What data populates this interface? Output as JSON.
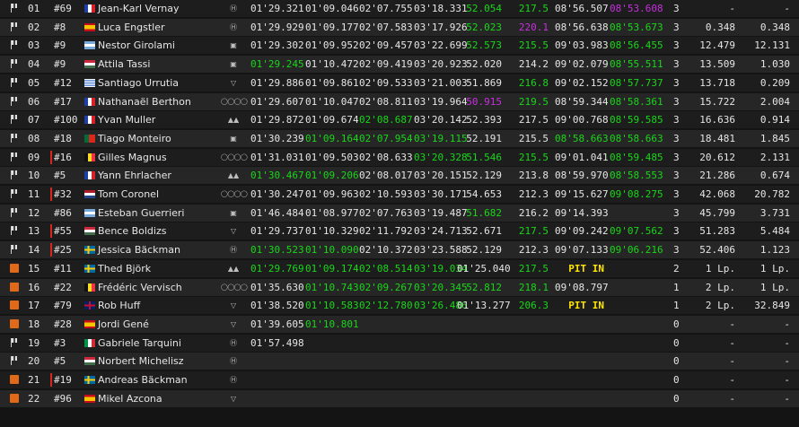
{
  "colors": {
    "personal_best": "#19d719",
    "overall_best": "#c72fdf",
    "pit": "#ffe600",
    "retired": "#e06a1a",
    "penalty": "#d9261c"
  },
  "rows": [
    {
      "status": "flag",
      "pos": "01",
      "num": "#69",
      "penalty": false,
      "flag": "fr",
      "driver": "Jean-Karl Vernay",
      "brand": "hyundai",
      "best": "01'29.321",
      "s1": "01'09.046",
      "s2": "02'07.755",
      "s3": "03'18.331",
      "spd1": "52.054",
      "spd1_c": "g",
      "spd2": "217.5",
      "spd2_c": "g",
      "lastlap": "08'56.507",
      "lastlap_c": "",
      "lap": "08'53.608",
      "lap_c": "p",
      "laps": "3",
      "gap": "-",
      "int": "-"
    },
    {
      "status": "flag",
      "pos": "02",
      "num": "#8",
      "penalty": false,
      "flag": "es",
      "driver": "Luca Engstler",
      "brand": "hyundai",
      "best": "01'29.929",
      "s1": "01'09.177",
      "s2": "02'07.583",
      "s3": "03'17.926",
      "spd1": "52.023",
      "spd1_c": "g",
      "spd2": "220.1",
      "spd2_c": "p",
      "lastlap": "08'56.638",
      "lastlap_c": "",
      "lap": "08'53.673",
      "lap_c": "g",
      "laps": "3",
      "gap": "0.348",
      "int": "0.348"
    },
    {
      "status": "flag",
      "pos": "03",
      "num": "#9",
      "penalty": false,
      "flag": "ar",
      "driver": "Nestor Girolami",
      "brand": "honda",
      "best": "01'29.302",
      "s1": "01'09.952",
      "s2": "02'09.457",
      "s3": "03'22.699",
      "spd1": "52.573",
      "spd1_c": "g",
      "spd2": "215.5",
      "spd2_c": "g",
      "lastlap": "09'03.983",
      "lastlap_c": "",
      "lap": "08'56.455",
      "lap_c": "g",
      "laps": "3",
      "gap": "12.479",
      "int": "12.131"
    },
    {
      "status": "flag",
      "pos": "04",
      "num": "#9",
      "penalty": false,
      "flag": "hu",
      "driver": "Attila Tassi",
      "brand": "honda",
      "best": "01'29.245",
      "best_c": "g",
      "s1": "01'10.472",
      "s2": "02'09.419",
      "s3": "03'20.923",
      "spd1": "52.020",
      "spd1_c": "",
      "spd2": "214.2",
      "spd2_c": "",
      "lastlap": "09'02.079",
      "lastlap_c": "",
      "lap": "08'55.511",
      "lap_c": "g",
      "laps": "3",
      "gap": "13.509",
      "int": "1.030"
    },
    {
      "status": "flag",
      "pos": "05",
      "num": "#12",
      "penalty": false,
      "flag": "uy",
      "driver": "Santiago Urrutia",
      "brand": "cupra",
      "best": "01'29.886",
      "s1": "01'09.861",
      "s2": "02'09.533",
      "s3": "03'21.003",
      "spd1": "51.869",
      "spd1_c": "",
      "spd2": "216.8",
      "spd2_c": "g",
      "lastlap": "09'02.152",
      "lastlap_c": "",
      "lap": "08'57.737",
      "lap_c": "g",
      "laps": "3",
      "gap": "13.718",
      "int": "0.209"
    },
    {
      "status": "flag",
      "pos": "06",
      "num": "#17",
      "penalty": false,
      "flag": "fr",
      "driver": "Nathanaël Berthon",
      "brand": "audi",
      "best": "01'29.607",
      "s1": "01'10.047",
      "s2": "02'08.811",
      "s3": "03'19.964",
      "spd1": "50.915",
      "spd1_c": "p",
      "spd2": "219.5",
      "spd2_c": "g",
      "lastlap": "08'59.344",
      "lastlap_c": "",
      "lap": "08'58.361",
      "lap_c": "g",
      "laps": "3",
      "gap": "15.722",
      "int": "2.004"
    },
    {
      "status": "flag",
      "pos": "07",
      "num": "#100",
      "penalty": false,
      "flag": "fr",
      "driver": "Yvan Muller",
      "brand": "lynk",
      "best": "01'29.872",
      "s1": "01'09.674",
      "s2": "02'08.687",
      "s2_c": "g",
      "s3": "03'20.142",
      "spd1": "52.393",
      "spd1_c": "",
      "spd2": "217.5",
      "spd2_c": "",
      "lastlap": "09'00.768",
      "lastlap_c": "",
      "lap": "08'59.585",
      "lap_c": "g",
      "laps": "3",
      "gap": "16.636",
      "int": "0.914"
    },
    {
      "status": "flag",
      "pos": "08",
      "num": "#18",
      "penalty": false,
      "flag": "pt",
      "driver": "Tiago Monteiro",
      "brand": "honda",
      "best": "01'30.239",
      "s1": "01'09.164",
      "s1_c": "g",
      "s2": "02'07.954",
      "s2_c": "g",
      "s3": "03'19.115",
      "s3_c": "g",
      "spd1": "52.191",
      "spd1_c": "",
      "spd2": "215.5",
      "spd2_c": "",
      "lastlap": "08'58.663",
      "lastlap_c": "g",
      "lap": "08'58.663",
      "lap_c": "g",
      "laps": "3",
      "gap": "18.481",
      "int": "1.845"
    },
    {
      "status": "flag",
      "pos": "09",
      "num": "#16",
      "penalty": true,
      "flag": "be",
      "driver": "Gilles Magnus",
      "brand": "audi",
      "best": "01'31.031",
      "s1": "01'09.503",
      "s2": "02'08.633",
      "s3": "03'20.328",
      "s3_c": "g",
      "spd1": "51.546",
      "spd1_c": "g",
      "spd2": "215.5",
      "spd2_c": "g",
      "lastlap": "09'01.041",
      "lastlap_c": "",
      "lap": "08'59.485",
      "lap_c": "g",
      "laps": "3",
      "gap": "20.612",
      "int": "2.131"
    },
    {
      "status": "flag",
      "pos": "10",
      "num": "#5",
      "penalty": false,
      "flag": "fr",
      "driver": "Yann Ehrlacher",
      "brand": "lynk",
      "best": "01'30.467",
      "best_c": "g",
      "s1": "01'09.206",
      "s1_c": "g",
      "s2": "02'08.017",
      "s3": "03'20.151",
      "spd1": "52.129",
      "spd1_c": "",
      "spd2": "213.8",
      "spd2_c": "",
      "lastlap": "08'59.970",
      "lastlap_c": "",
      "lap": "08'58.553",
      "lap_c": "g",
      "laps": "3",
      "gap": "21.286",
      "int": "0.674"
    },
    {
      "status": "flag",
      "pos": "11",
      "num": "#32",
      "penalty": true,
      "flag": "nl",
      "driver": "Tom Coronel",
      "brand": "audi",
      "best": "01'30.247",
      "s1": "01'09.963",
      "s2": "02'10.593",
      "s3": "03'30.171",
      "spd1": "54.653",
      "spd1_c": "",
      "spd2": "212.3",
      "spd2_c": "",
      "lastlap": "09'15.627",
      "lastlap_c": "",
      "lap": "09'08.275",
      "lap_c": "g",
      "laps": "3",
      "gap": "42.068",
      "int": "20.782"
    },
    {
      "status": "flag",
      "pos": "12",
      "num": "#86",
      "penalty": false,
      "flag": "ar",
      "driver": "Esteban Guerrieri",
      "brand": "honda",
      "best": "01'46.484",
      "s1": "01'08.977",
      "s2": "02'07.763",
      "s3": "03'19.487",
      "spd1": "51.682",
      "spd1_c": "g",
      "spd2": "216.2",
      "spd2_c": "",
      "lastlap": "09'14.393",
      "lastlap_c": "",
      "lap": "",
      "lap_c": "",
      "laps": "3",
      "gap": "45.799",
      "int": "3.731"
    },
    {
      "status": "flag",
      "pos": "13",
      "num": "#55",
      "penalty": true,
      "flag": "hu",
      "driver": "Bence Boldizs",
      "brand": "cupra",
      "best": "01'29.737",
      "s1": "01'10.329",
      "s2": "02'11.792",
      "s3": "03'24.713",
      "spd1": "52.671",
      "spd1_c": "",
      "spd2": "217.5",
      "spd2_c": "g",
      "lastlap": "09'09.242",
      "lastlap_c": "",
      "lap": "09'07.562",
      "lap_c": "g",
      "laps": "3",
      "gap": "51.283",
      "int": "5.484"
    },
    {
      "status": "flag",
      "pos": "14",
      "num": "#25",
      "penalty": true,
      "flag": "se",
      "driver": "Jessica Bäckman",
      "brand": "hyundai",
      "best": "01'30.523",
      "best_c": "g",
      "s1": "01'10.090",
      "s1_c": "g",
      "s2": "02'10.372",
      "s3": "03'23.588",
      "spd1": "52.129",
      "spd1_c": "",
      "spd2": "212.3",
      "spd2_c": "",
      "lastlap": "09'07.133",
      "lastlap_c": "",
      "lap": "09'06.216",
      "lap_c": "g",
      "laps": "3",
      "gap": "52.406",
      "int": "1.123"
    },
    {
      "status": "retired",
      "pos": "15",
      "num": "#11",
      "penalty": false,
      "flag": "se",
      "driver": "Thed Björk",
      "brand": "lynk",
      "best": "01'29.769",
      "best_c": "g",
      "s1": "01'09.174",
      "s1_c": "g",
      "s2": "02'08.514",
      "s2_c": "g",
      "s3": "03'19.034",
      "s3_c": "g",
      "spd1": "01'25.040",
      "spd1_c": "",
      "spd2": "217.5",
      "spd2_c": "g",
      "lastlap": "PIT IN",
      "lastlap_c": "y",
      "lap": "",
      "lap_c": "",
      "laps": "2",
      "gap": "1 Lp.",
      "int": "1 Lp."
    },
    {
      "status": "retired",
      "pos": "16",
      "num": "#22",
      "penalty": false,
      "flag": "be",
      "driver": "Frédéric Vervisch",
      "brand": "audi",
      "best": "01'35.630",
      "s1": "01'10.743",
      "s1_c": "g",
      "s2": "02'09.267",
      "s2_c": "g",
      "s3": "03'20.345",
      "s3_c": "g",
      "spd1": "52.812",
      "spd1_c": "g",
      "spd2": "218.1",
      "spd2_c": "g",
      "lastlap": "09'08.797",
      "lastlap_c": "",
      "lap": "",
      "lap_c": "",
      "laps": "1",
      "gap": "2 Lp.",
      "int": "1 Lp."
    },
    {
      "status": "retired",
      "pos": "17",
      "num": "#79",
      "penalty": false,
      "flag": "gb",
      "driver": "Rob Huff",
      "brand": "cupra",
      "best": "01'38.520",
      "s1": "01'10.583",
      "s1_c": "g",
      "s2": "02'12.780",
      "s2_c": "g",
      "s3": "03'26.486",
      "s3_c": "g",
      "spd1": "01'13.277",
      "spd1_c": "",
      "spd2": "206.3",
      "spd2_c": "g",
      "lastlap": "PIT IN",
      "lastlap_c": "y",
      "lap": "",
      "lap_c": "",
      "laps": "1",
      "gap": "2 Lp.",
      "int": "32.849"
    },
    {
      "status": "retired",
      "pos": "18",
      "num": "#28",
      "penalty": false,
      "flag": "es",
      "driver": "Jordi Gené",
      "brand": "cupra",
      "best": "01'39.605",
      "s1": "01'10.801",
      "s1_c": "g",
      "s2": "",
      "s3": "",
      "spd1": "",
      "spd1_c": "",
      "spd2": "",
      "spd2_c": "",
      "lastlap": "",
      "lastlap_c": "",
      "lap": "",
      "lap_c": "",
      "laps": "0",
      "gap": "-",
      "int": "-"
    },
    {
      "status": "flag",
      "pos": "19",
      "num": "#3",
      "penalty": false,
      "flag": "it",
      "driver": "Gabriele Tarquini",
      "brand": "hyundai",
      "best": "01'57.498",
      "s1": "",
      "s2": "",
      "s3": "",
      "spd1": "",
      "spd1_c": "",
      "spd2": "",
      "spd2_c": "",
      "lastlap": "",
      "lastlap_c": "",
      "lap": "",
      "lap_c": "",
      "laps": "0",
      "gap": "-",
      "int": "-"
    },
    {
      "status": "flag",
      "pos": "20",
      "num": "#5",
      "penalty": false,
      "flag": "hu",
      "driver": "Norbert Michelisz",
      "brand": "hyundai",
      "best": "",
      "s1": "",
      "s2": "",
      "s3": "",
      "spd1": "",
      "spd1_c": "",
      "spd2": "",
      "spd2_c": "",
      "lastlap": "",
      "lastlap_c": "",
      "lap": "",
      "lap_c": "",
      "laps": "0",
      "gap": "-",
      "int": "-"
    },
    {
      "status": "retired",
      "pos": "21",
      "num": "#19",
      "penalty": true,
      "flag": "se",
      "driver": "Andreas Bäckman",
      "brand": "hyundai",
      "best": "",
      "s1": "",
      "s2": "",
      "s3": "",
      "spd1": "",
      "spd1_c": "",
      "spd2": "",
      "spd2_c": "",
      "lastlap": "",
      "lastlap_c": "",
      "lap": "",
      "lap_c": "",
      "laps": "0",
      "gap": "-",
      "int": "-"
    },
    {
      "status": "retired",
      "pos": "22",
      "num": "#96",
      "penalty": false,
      "flag": "es",
      "driver": "Mikel Azcona",
      "brand": "cupra",
      "best": "",
      "s1": "",
      "s2": "",
      "s3": "",
      "spd1": "",
      "spd1_c": "",
      "spd2": "",
      "spd2_c": "",
      "lastlap": "",
      "lastlap_c": "",
      "lap": "",
      "lap_c": "",
      "laps": "0",
      "gap": "-",
      "int": "-"
    }
  ]
}
